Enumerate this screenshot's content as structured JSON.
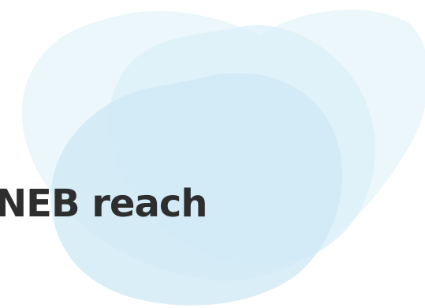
{
  "headline": {
    "text": "NEB reach",
    "color": "#2e2e2e"
  },
  "background": {
    "color": "#ffffff",
    "blob_colors": [
      "#e6f4fa",
      "#dcf0f8",
      "#cde8f4"
    ]
  }
}
